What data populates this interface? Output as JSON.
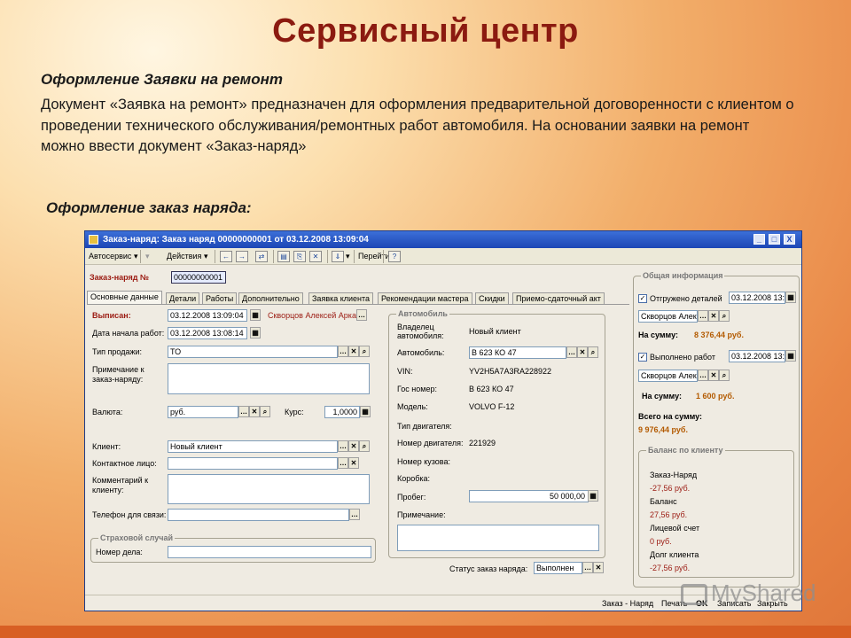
{
  "slide": {
    "title": "Сервисный центр",
    "subtitle": "Оформление Заявки на ремонт",
    "description": "Документ «Заявка на ремонт» предназначен для оформления предварительной договоренности с клиентом о проведении технического обслуживания/ремонтных работ автомобиля. На основании заявки на ремонт можно ввести документ «Заказ-наряд»",
    "subtitle2": "Оформление заказ наряда:",
    "watermark": "MyShared"
  },
  "window": {
    "title": "Заказ-наряд: Заказ наряд 00000000001 от 03.12.2008 13:09:04",
    "controls": [
      "_",
      "□",
      "X"
    ]
  },
  "toolbar": {
    "service": "Автосервис",
    "actions": "Действия",
    "goto": "Перейти",
    "help": "?"
  },
  "doc": {
    "number_label": "Заказ-наряд №",
    "number": "00000000001"
  },
  "tabs": [
    "Основные данные",
    "Детали",
    "Работы",
    "Дополнительно",
    "Заявка клиента",
    "Рекомендации мастера",
    "Скидки",
    "Приемо-сдаточный акт"
  ],
  "form": {
    "issued_label": "Выписан:",
    "issued": "03.12.2008 13:09:04",
    "issued_by": "Скворцов Алексей Аркад...",
    "start_label": "Дата начала работ:",
    "start": "03.12.2008 13:08:14",
    "sale_type_label": "Тип продажи:",
    "sale_type": "ТО",
    "note_label": "Примечание к заказ-наряду:",
    "currency_label": "Валюта:",
    "currency": "руб.",
    "rate_label": "Курс:",
    "rate": "1,0000",
    "client_label": "Клиент:",
    "client": "Новый клиент",
    "contact_label": "Контактное лицо:",
    "comment_label": "Комментарий к клиенту:",
    "phone_label": "Телефон для связи:",
    "insurance_group": "Страховой случай",
    "case_label": "Номер дела:"
  },
  "car": {
    "group": "Автомобиль",
    "owner_label": "Владелец автомобиля:",
    "owner": "Новый клиент",
    "car_label": "Автомобиль:",
    "car": "В 623 КО 47",
    "vin_label": "VIN:",
    "vin": "YV2H5A7A3RA228922",
    "plate_label": "Гос номер:",
    "plate": "В 623 КО 47",
    "model_label": "Модель:",
    "model": "VOLVO F-12",
    "engine_type_label": "Тип двигателя:",
    "engine_no_label": "Номер двигателя:",
    "engine_no": "221929",
    "body_no_label": "Номер кузова:",
    "gearbox_label": "Коробка:",
    "mileage_label": "Пробег:",
    "mileage": "50 000,00",
    "note_label": "Примечание:",
    "status_label": "Статус заказ наряда:",
    "status": "Выполнен"
  },
  "info": {
    "group": "Общая информация",
    "parts_shipped_label": "Отгружено деталей",
    "parts_date": "03.12.2008 13:",
    "person1": "Скворцов Алек",
    "sum1_label": "На сумму:",
    "sum1": "8 376,44 руб.",
    "works_done_label": "Выполнено работ",
    "works_date": "03.12.2008 13:",
    "person2": "Скворцов Алек",
    "sum2_label": "На сумму:",
    "sum2": "1 600 руб.",
    "total_label": "Всего на сумму:",
    "total": "9 976,44 руб.",
    "balance_group": "Баланс по клиенту",
    "b1_label": "Заказ-Наряд",
    "b1": "-27,56 руб.",
    "b2_label": "Баланс",
    "b2": "27,56 руб.",
    "b3_label": "Лицевой счет",
    "b3": "0 руб.",
    "b4_label": "Долг клиента",
    "b4": "-27,56 руб."
  },
  "statusbar": {
    "doc": "Заказ - Наряд",
    "print": "Печать",
    "ok": "OK",
    "save": "Записать",
    "close": "Закрыть"
  }
}
